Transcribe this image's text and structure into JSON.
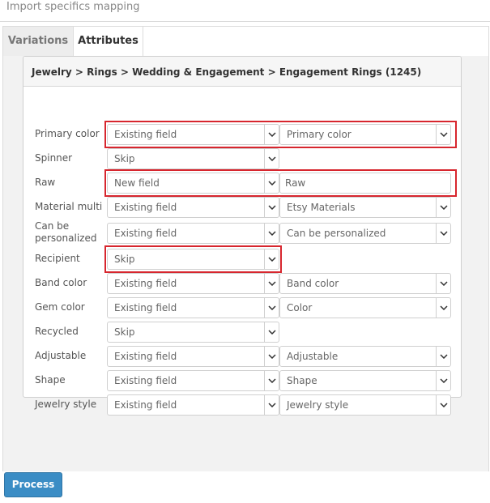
{
  "header": {
    "title": "Import specifics mapping"
  },
  "tabs": [
    {
      "label": "Variations",
      "active": false
    },
    {
      "label": "Attributes",
      "active": true
    }
  ],
  "card": {
    "category_path": "Jewelry > Rings > Wedding & Engagement > Engagement Rings (1245)"
  },
  "rows": [
    {
      "label": "Primary color",
      "mode": "Existing field",
      "target": "Primary color",
      "target_kind": "select",
      "highlighted": true
    },
    {
      "label": "Spinner",
      "mode": "Skip"
    },
    {
      "label": "Raw",
      "mode": "New field",
      "target": "Raw",
      "target_kind": "input",
      "highlighted": true
    },
    {
      "label": "Material multi",
      "mode": "Existing field",
      "target": "Etsy Materials",
      "target_kind": "select"
    },
    {
      "label": "Can be personalized",
      "mode": "Existing field",
      "target": "Can be personalized",
      "target_kind": "select"
    },
    {
      "label": "Recipient",
      "mode": "Skip",
      "highlighted": true
    },
    {
      "label": "Band color",
      "mode": "Existing field",
      "target": "Band color",
      "target_kind": "select"
    },
    {
      "label": "Gem color",
      "mode": "Existing field",
      "target": "Color",
      "target_kind": "select"
    },
    {
      "label": "Recycled",
      "mode": "Skip"
    },
    {
      "label": "Adjustable",
      "mode": "Existing field",
      "target": "Adjustable",
      "target_kind": "select"
    },
    {
      "label": "Shape",
      "mode": "Existing field",
      "target": "Shape",
      "target_kind": "select"
    },
    {
      "label": "Jewelry style",
      "mode": "Existing field",
      "target": "Jewelry style",
      "target_kind": "select"
    }
  ],
  "process_button": {
    "label": "Process"
  },
  "colors": {
    "highlight": "#d7262e",
    "button": "#3b8dc5"
  },
  "icons": {
    "dropdown": "chevron-down-icon"
  }
}
